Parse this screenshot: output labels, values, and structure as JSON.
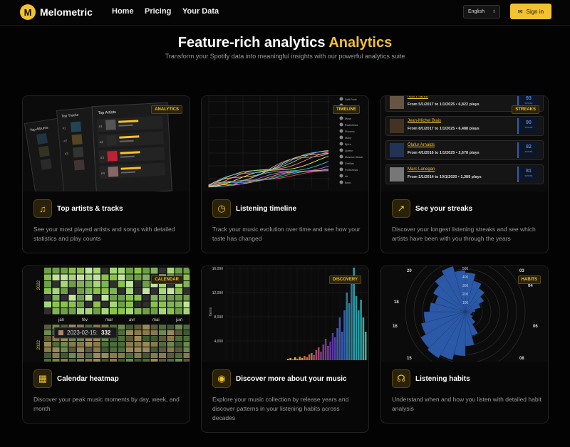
{
  "nav": {
    "logo": "M",
    "brand": "Melometric",
    "links": [
      "Home",
      "Pricing",
      "Your Data"
    ],
    "language": "English",
    "signin": "Sign in"
  },
  "hero": {
    "title": "Feature-rich analytics",
    "title_highlight": "Analytics",
    "subtitle": "Transform your Spotify data into meaningful insights with our powerful analytics suite"
  },
  "colors": {
    "accent": "#f2c230",
    "background": "#030303"
  },
  "cards": [
    {
      "badge": "ANALYTICS",
      "icon": "music-note-icon",
      "title": "Top artists & tracks",
      "desc": "See your most played artists and songs with detailed statistics and play counts",
      "preview": {
        "panels": [
          "Top Albums",
          "Top Tracks",
          "Top Artists"
        ],
        "ranks": [
          "#1",
          "#2",
          "#3",
          "#4"
        ]
      }
    },
    {
      "badge": "TIMELINE",
      "icon": "clock-icon",
      "title": "Listening timeline",
      "desc": "Track your music evolution over time and see how your taste has changed",
      "preview": {
        "legend": [
          "Daft Punk",
          "Air",
          "Justice",
          "Muse",
          "Radiohead",
          "Phoenix",
          "Moby",
          "Björk",
          "Queen",
          "Massive Attack",
          "Gorillaz",
          "Portishead",
          "Air",
          "Beck"
        ]
      }
    },
    {
      "badge": "STREAKS",
      "icon": "trending-up-icon",
      "title": "See your streaks",
      "desc": "Discover your longest listening streaks and see which artists have been with you through the years",
      "preview": {
        "streaks": [
          {
            "name": "Nils Frahm",
            "range": "From 5/1/2017 to 1/1/2025",
            "plays": "6,822 plays",
            "score": "93",
            "label": "streak"
          },
          {
            "name": "Jean-Michel Blais",
            "range": "From 8/1/2017 to 1/1/2025",
            "plays": "6,488 plays",
            "score": "90",
            "label": "streak"
          },
          {
            "name": "Ólafur Arnalds",
            "range": "From 4/1/2016 to 1/1/2025",
            "plays": "2,678 plays",
            "score": "82",
            "label": "streak"
          },
          {
            "name": "Marc Lanegan",
            "range": "From 2/1/2014 to 10/1/2020",
            "plays": "1,389 plays",
            "score": "81",
            "label": "streak"
          }
        ]
      }
    },
    {
      "badge": "CALENDAR",
      "icon": "calendar-icon",
      "title": "Calendar heatmap",
      "desc": "Discover your peak music moments by day, week, and month",
      "preview": {
        "year_top": "2022",
        "year_bottom": "2022",
        "months": [
          "jan",
          "fév",
          "mar",
          "avr",
          "mai",
          "juin"
        ],
        "tooltip_date": "2023-02-15:",
        "tooltip_value": "332"
      }
    },
    {
      "badge": "DISCOVERY",
      "icon": "palette-icon",
      "title": "Discover more about your music",
      "desc": "Explore your music collection by release years and discover patterns in your listening habits across decades",
      "preview": {
        "ylabel": "Items",
        "yticks": [
          "16,000",
          "12,000",
          "8,000",
          "4,000"
        ]
      }
    },
    {
      "badge": "HABITS",
      "icon": "headphones-icon",
      "title": "Listening habits",
      "desc": "Understand when and how you listen with detailed habit analysis",
      "preview": {
        "hours": [
          "20",
          "03",
          "04",
          "18",
          "16",
          "06",
          "15",
          "08"
        ],
        "rings": [
          "500",
          "400",
          "300",
          "200",
          "100"
        ]
      }
    }
  ]
}
